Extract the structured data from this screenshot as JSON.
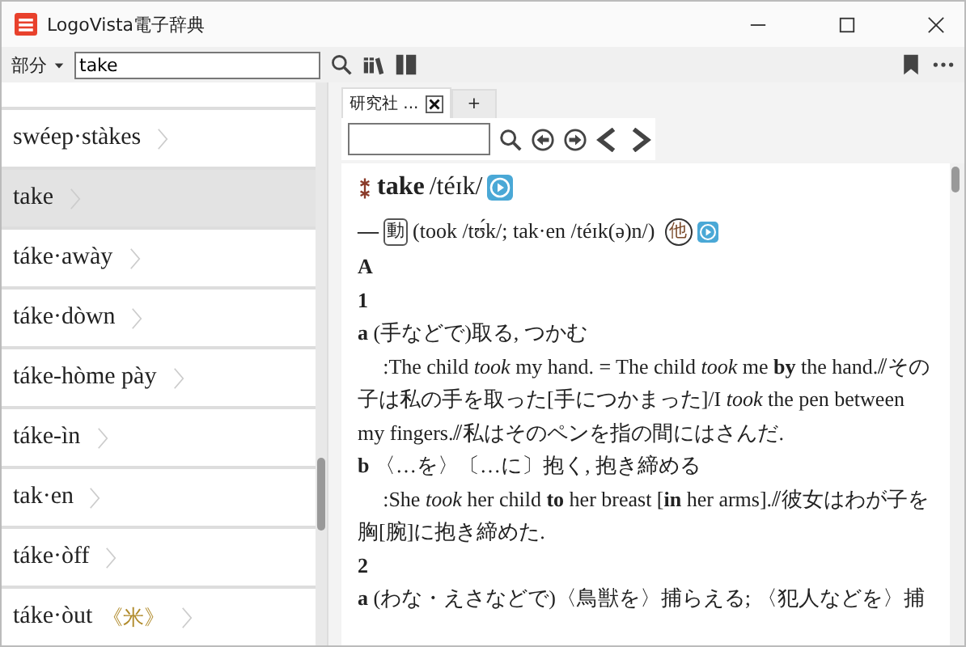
{
  "window": {
    "title": "LogoVista電子辞典"
  },
  "toolbar": {
    "mode": "部分",
    "search": {
      "value": "take"
    }
  },
  "word_list": [
    {
      "label": "swéep·stàkes",
      "selected": false
    },
    {
      "label": "take",
      "selected": true
    },
    {
      "label": "táke·awày",
      "selected": false
    },
    {
      "label": "táke·dòwn",
      "selected": false
    },
    {
      "label": "táke-hòme pày",
      "selected": false
    },
    {
      "label": "táke-ìn",
      "selected": false
    },
    {
      "label": "tak·en",
      "selected": false
    },
    {
      "label": "táke·òff",
      "selected": false
    },
    {
      "label": "táke·òut",
      "tag": "《米》",
      "selected": false
    }
  ],
  "tabs": [
    {
      "label": "研究社 ...",
      "selected": true
    },
    {
      "label": "+",
      "selected": false
    }
  ],
  "entry": {
    "headword": "take",
    "pronunciation": "/téɪk/",
    "dash": "—",
    "pos": "動",
    "forms": "(took /tʊ́k/; tak·en /téɪk(ə)n/)",
    "transitivity": "他",
    "blocks": [
      {
        "kind": "heading",
        "text": "A"
      },
      {
        "kind": "heading",
        "text": "1"
      },
      {
        "kind": "sense",
        "text": "**a** (手などで)取る, つかむ"
      },
      {
        "kind": "example",
        "text": ":The child *took* my hand. = The child *took* me **by** the hand.⫽その子は私の手を取った[手につかまった]/I *took* the pen between my fingers.⫽私はそのペンを指の間にはさんだ."
      },
      {
        "kind": "sense",
        "text": "**b** 〈…を〉〔…に〕抱く, 抱き締める"
      },
      {
        "kind": "example",
        "text": ":She *took* her child **to** her breast [**in** her arms].⫽彼女はわが子を胸[腕]に抱き締めた."
      },
      {
        "kind": "heading",
        "text": "2"
      },
      {
        "kind": "sense",
        "text": "**a** (わな・えさなどで)〈鳥獣を〉捕らえる; 〈犯人などを〉捕"
      }
    ]
  }
}
